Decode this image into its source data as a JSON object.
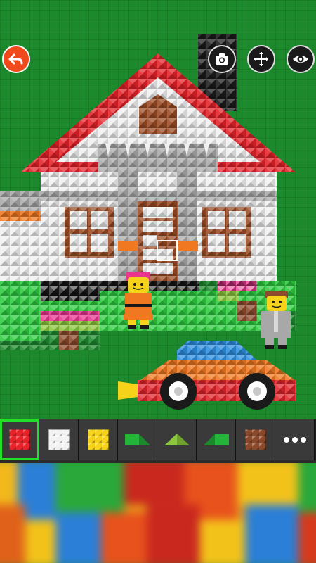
{
  "app": {
    "screen": "brick-builder-canvas"
  },
  "toolbar": {
    "undo": {
      "icon": "undo-arrow-icon"
    },
    "tools": [
      {
        "name": "camera",
        "icon": "camera-icon"
      },
      {
        "name": "move",
        "icon": "move-arrows-icon"
      },
      {
        "name": "view",
        "icon": "eye-icon"
      }
    ]
  },
  "palette": {
    "selected_index": 0,
    "items": [
      {
        "name": "red-brick",
        "color": "#e8242b",
        "shape": "square"
      },
      {
        "name": "white-brick",
        "color": "#f2f2f2",
        "shape": "square"
      },
      {
        "name": "yellow-brick",
        "color": "#f6d21b",
        "shape": "square"
      },
      {
        "name": "green-slope",
        "color": "#23b43a",
        "shape": "slope-left"
      },
      {
        "name": "lime-slope",
        "color": "#8cc63e",
        "shape": "roof"
      },
      {
        "name": "green-slope-2",
        "color": "#23b43a",
        "shape": "slope-right"
      },
      {
        "name": "brown-brick",
        "color": "#8b4a2b",
        "shape": "square"
      },
      {
        "name": "more",
        "icon": "more-dots-icon"
      }
    ]
  },
  "scene": {
    "baseplate_color": "#1c8a2c",
    "roof_color": "#e32128",
    "wall_color": "#f0f0f0",
    "trim_color": "#a8a8a8",
    "chimney_color": "#1a1a1a",
    "window_frame_color": "#9a4a22",
    "door_color": "#9a4a22",
    "car_body_color": "#f07820",
    "car_roof_color": "#2e8fe0",
    "car_base_color": "#e0242b",
    "hedge_color": "#2ecc40",
    "flower_color": "#e8368e",
    "figure_girl_colors": {
      "hair": "#e8368e",
      "face": "#f6d21b",
      "shirt": "#f07820",
      "pants": "#f6d21b"
    },
    "figure_boy_colors": {
      "hair": "#8b4a2b",
      "face": "#f6d21b",
      "suit": "#a8a8a8"
    }
  }
}
